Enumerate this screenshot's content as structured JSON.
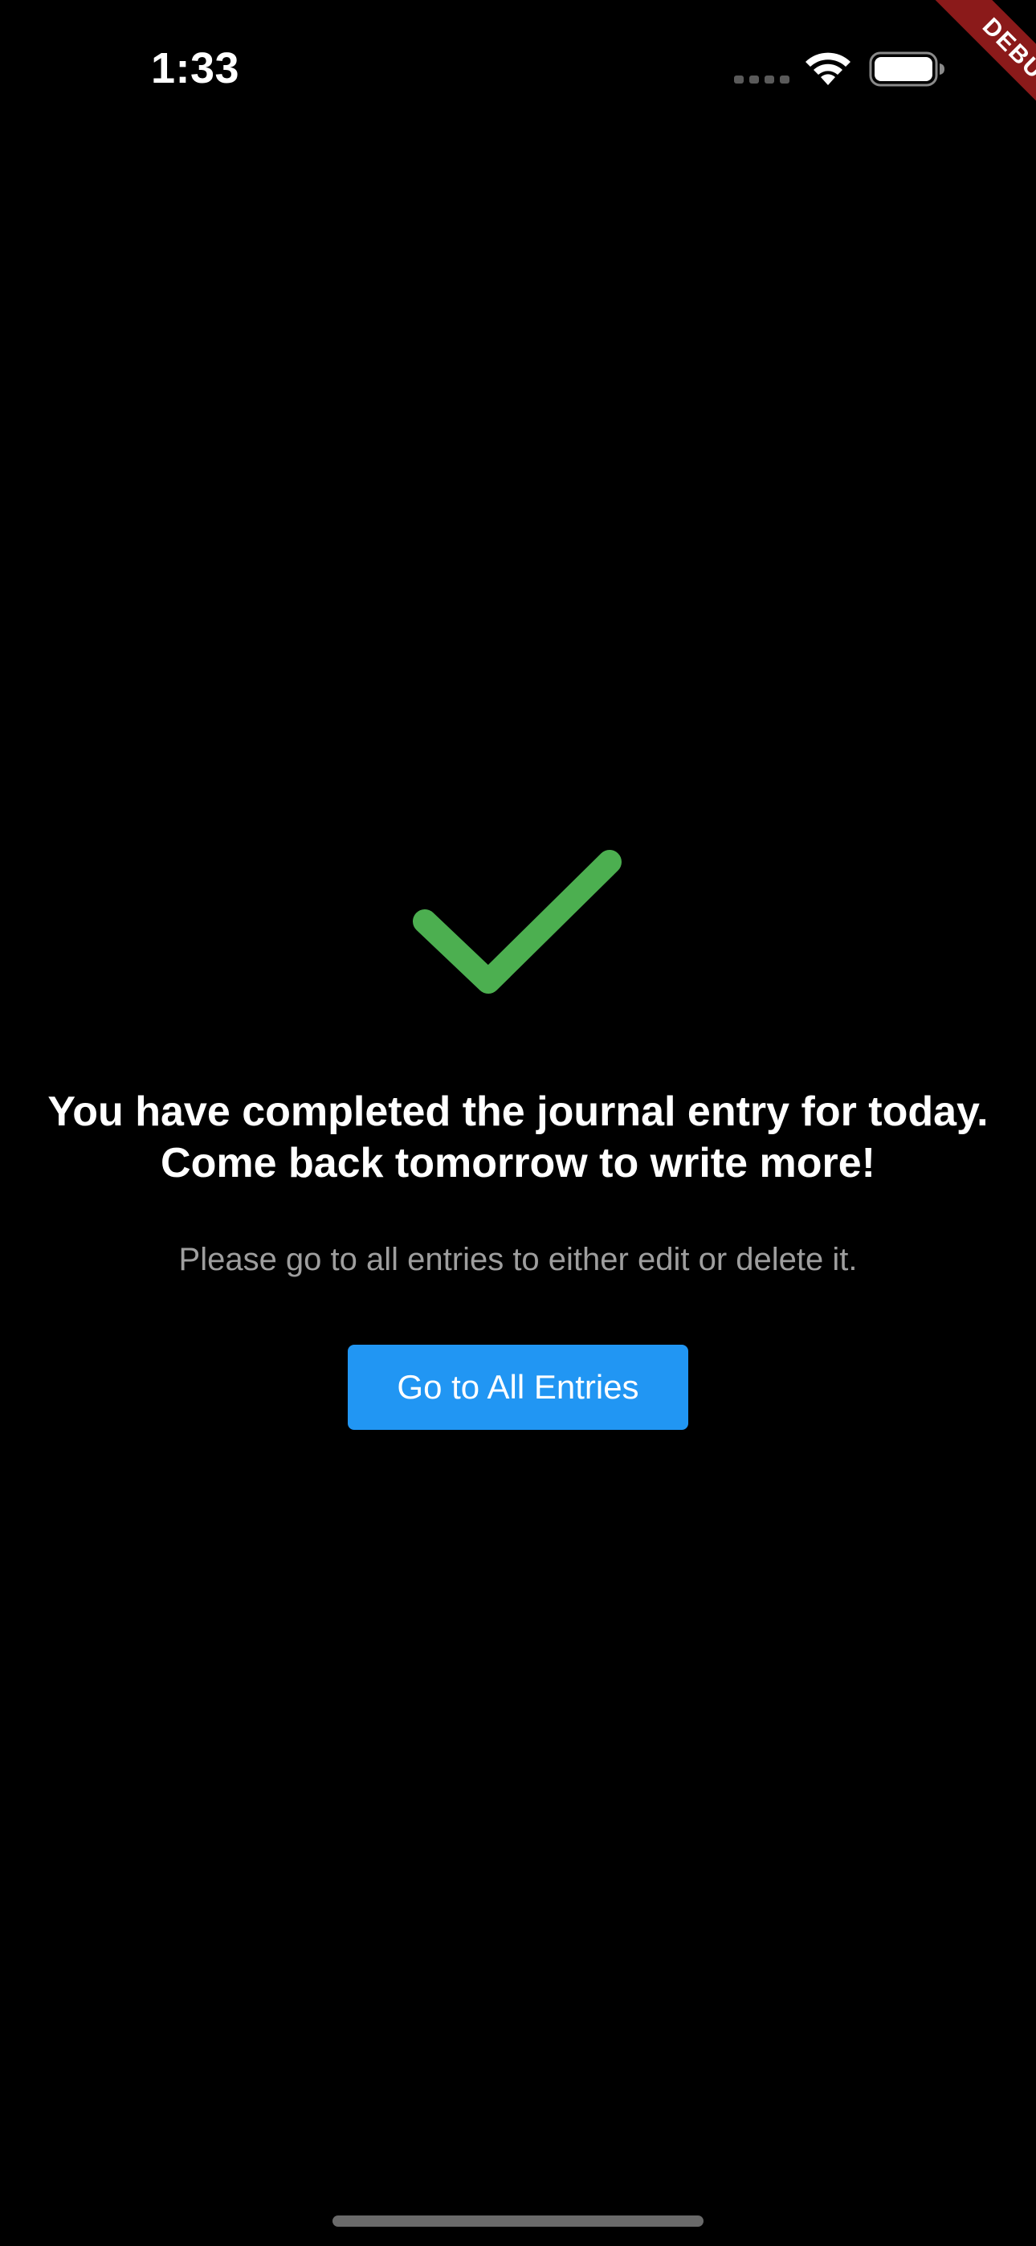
{
  "status_bar": {
    "time": "1:33",
    "icons": [
      "cellular-signal-icon",
      "wifi-icon",
      "battery-icon"
    ]
  },
  "debug_banner": {
    "label": "DEBUG",
    "color": "#8b1a1a"
  },
  "main": {
    "icon": "checkmark-icon",
    "icon_color": "#4caf50",
    "headline": "You have completed the journal entry for today. Come back tomorrow to write more!",
    "subtext": "Please go to all entries to either edit or delete it.",
    "button_label": "Go to All Entries",
    "button_color": "#2196f3"
  },
  "colors": {
    "background": "#000000",
    "text_primary": "#ffffff",
    "text_secondary": "#9e9e9e"
  }
}
